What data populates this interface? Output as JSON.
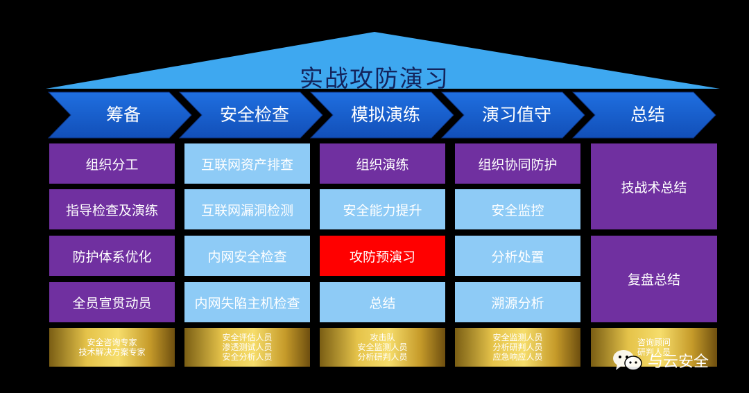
{
  "title": "实战攻防演习",
  "colors": {
    "roof": "#3ea8f0",
    "arrow": "#1a63d6",
    "purple": "#7030a0",
    "light_blue": "#8ecbf6",
    "highlight_red": "#ff0000",
    "gold": "#e5c34a"
  },
  "phases": [
    {
      "label": "筹备",
      "items": [
        "组织分工",
        "指导检查及演练",
        "防护体系优化",
        "全员宣贯动员"
      ],
      "staff": [
        "安全咨询专家",
        "技术解决方案专家"
      ]
    },
    {
      "label": "安全检查",
      "items": [
        "互联网资产排查",
        "互联网漏洞检测",
        "内网安全检查",
        "内网失陷主机检查"
      ],
      "staff": [
        "安全评估人员",
        "渗透测试人员",
        "安全分析人员"
      ]
    },
    {
      "label": "模拟演练",
      "items": [
        "组织演练",
        "安全能力提升",
        "攻防预演习",
        "总结"
      ],
      "staff": [
        "攻击队",
        "安全监测人员",
        "分析研判人员"
      ]
    },
    {
      "label": "演习值守",
      "items": [
        "组织协同防护",
        "安全监控",
        "分析处置",
        "溯源分析"
      ],
      "staff": [
        "安全监测人员",
        "分析研判人员",
        "应急响应人员"
      ]
    },
    {
      "label": "总结",
      "items": [
        "技战术总结",
        "复盘总结"
      ],
      "staff": [
        "咨询顾问",
        "研判人员"
      ]
    }
  ],
  "watermark": {
    "text": "与云安全",
    "icon": "wechat-icon"
  }
}
